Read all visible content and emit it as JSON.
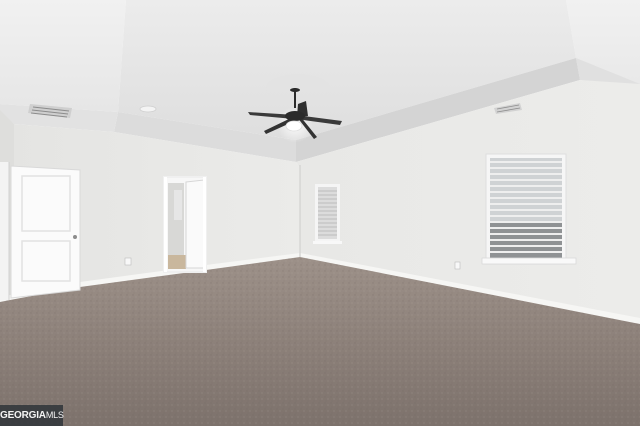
{
  "watermark": {
    "brand": "GEORGIA",
    "suffix": "MLS"
  }
}
